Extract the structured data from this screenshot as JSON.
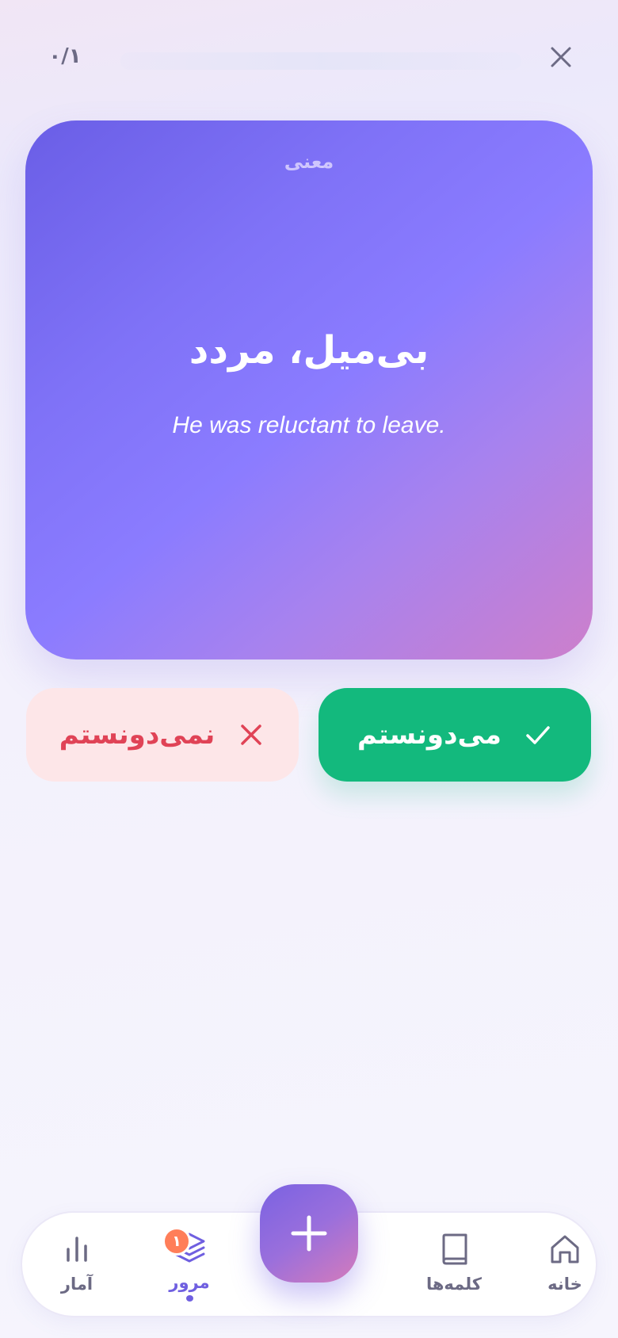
{
  "header": {
    "progress_text": "۰/۱",
    "progress_fraction": 0,
    "close_icon": "close-icon"
  },
  "card": {
    "label": "معنی",
    "meaning": "بی‌میل، مردد",
    "example": "He was reluctant to leave."
  },
  "actions": {
    "knew_label": "می‌دونستم",
    "knew_icon": "check-icon",
    "unknown_label": "نمی‌دونستم",
    "unknown_icon": "x-icon"
  },
  "nav": {
    "items": [
      {
        "label": "آمار",
        "icon": "stats-icon"
      },
      {
        "label": "مرور",
        "icon": "layers-icon",
        "badge": "۱",
        "active": true
      },
      {
        "label": "کلمه‌ها",
        "icon": "book-icon"
      },
      {
        "label": "خانه",
        "icon": "home-icon"
      }
    ],
    "fab_icon": "plus-icon"
  },
  "colors": {
    "accent": "#6f5fe0",
    "success": "#13b97d",
    "danger": "#e04356",
    "badge": "#ff7e59"
  }
}
